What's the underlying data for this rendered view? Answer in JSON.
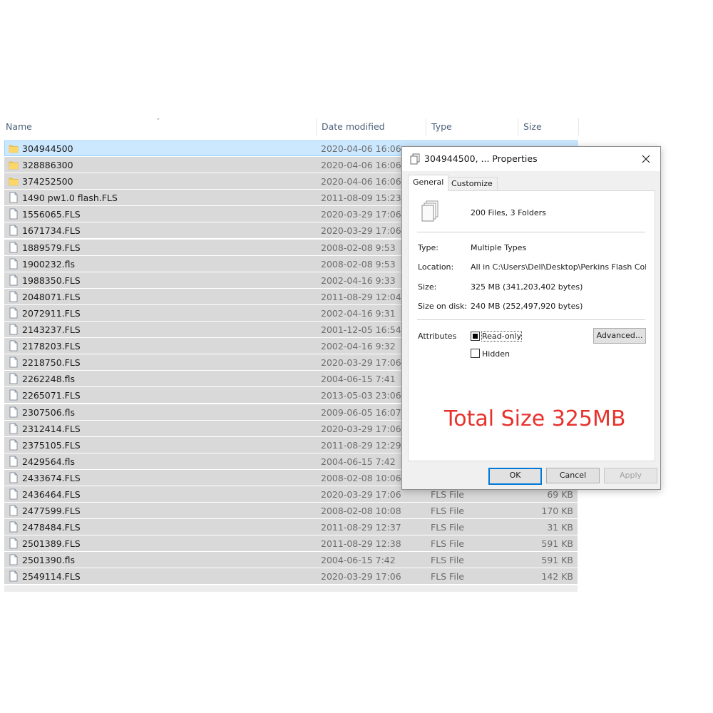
{
  "columns": {
    "name": "Name",
    "date": "Date modified",
    "type": "Type",
    "size": "Size"
  },
  "rows": [
    {
      "name": "304944500",
      "date": "2020-04-06 16:06",
      "type": "",
      "size": "",
      "icon": "folder-icon",
      "selected": true
    },
    {
      "name": "328886300",
      "date": "2020-04-06 16:06",
      "type": "",
      "size": "",
      "icon": "folder-icon"
    },
    {
      "name": "374252500",
      "date": "2020-04-06 16:06",
      "type": "",
      "size": "",
      "icon": "folder-icon"
    },
    {
      "name": "1490 pw1.0 flash.FLS",
      "date": "2011-08-09 15:23",
      "type": "",
      "size": "",
      "icon": "file-icon"
    },
    {
      "name": "1556065.FLS",
      "date": "2020-03-29 17:06",
      "type": "",
      "size": "",
      "icon": "file-icon"
    },
    {
      "name": "1671734.FLS",
      "date": "2020-03-29 17:06",
      "type": "",
      "size": "",
      "icon": "file-icon"
    },
    {
      "name": "1889579.FLS",
      "date": "2008-02-08 9:53",
      "type": "",
      "size": "",
      "icon": "file-icon"
    },
    {
      "name": "1900232.fls",
      "date": "2008-02-08 9:53",
      "type": "",
      "size": "",
      "icon": "file-icon"
    },
    {
      "name": "1988350.FLS",
      "date": "2002-04-16 9:33",
      "type": "",
      "size": "",
      "icon": "file-icon"
    },
    {
      "name": "2048071.FLS",
      "date": "2011-08-29 12:04",
      "type": "",
      "size": "",
      "icon": "file-icon"
    },
    {
      "name": "2072911.FLS",
      "date": "2002-04-16 9:31",
      "type": "",
      "size": "",
      "icon": "file-icon"
    },
    {
      "name": "2143237.FLS",
      "date": "2001-12-05 16:54",
      "type": "",
      "size": "",
      "icon": "file-icon"
    },
    {
      "name": "2178203.FLS",
      "date": "2002-04-16 9:32",
      "type": "",
      "size": "",
      "icon": "file-icon"
    },
    {
      "name": "2218750.FLS",
      "date": "2020-03-29 17:06",
      "type": "",
      "size": "",
      "icon": "file-icon"
    },
    {
      "name": "2262248.fls",
      "date": "2004-06-15 7:41",
      "type": "",
      "size": "",
      "icon": "file-icon"
    },
    {
      "name": "2265071.FLS",
      "date": "2013-05-03 23:06",
      "type": "",
      "size": "",
      "icon": "file-icon"
    },
    {
      "name": "2307506.fls",
      "date": "2009-06-05 16:07",
      "type": "",
      "size": "",
      "icon": "file-icon"
    },
    {
      "name": "2312414.FLS",
      "date": "2020-03-29 17:06",
      "type": "",
      "size": "",
      "icon": "file-icon"
    },
    {
      "name": "2375105.FLS",
      "date": "2011-08-29 12:29",
      "type": "",
      "size": "",
      "icon": "file-icon"
    },
    {
      "name": "2429564.fls",
      "date": "2004-06-15 7:42",
      "type": "",
      "size": "",
      "icon": "file-icon"
    },
    {
      "name": "2433674.FLS",
      "date": "2008-02-08 10:06",
      "type": "",
      "size": "",
      "icon": "file-icon"
    },
    {
      "name": "2436464.FLS",
      "date": "2020-03-29 17:06",
      "type": "FLS File",
      "size": "69 KB",
      "icon": "file-icon"
    },
    {
      "name": "2477599.FLS",
      "date": "2008-02-08 10:08",
      "type": "FLS File",
      "size": "170 KB",
      "icon": "file-icon"
    },
    {
      "name": "2478484.FLS",
      "date": "2011-08-29 12:37",
      "type": "FLS File",
      "size": "31 KB",
      "icon": "file-icon"
    },
    {
      "name": "2501389.FLS",
      "date": "2011-08-29 12:38",
      "type": "FLS File",
      "size": "591 KB",
      "icon": "file-icon"
    },
    {
      "name": "2501390.fls",
      "date": "2004-06-15 7:42",
      "type": "FLS File",
      "size": "591 KB",
      "icon": "file-icon"
    },
    {
      "name": "2549114.FLS",
      "date": "2020-03-29 17:06",
      "type": "FLS File",
      "size": "142 KB",
      "icon": "file-icon"
    }
  ],
  "dialog": {
    "title": "304944500, ... Properties",
    "tabs": {
      "general": "General",
      "customize": "Customize"
    },
    "summary": "200 Files, 3 Folders",
    "type_label": "Type:",
    "type_value": "Multiple Types",
    "location_label": "Location:",
    "location_value": "All in C:\\Users\\Dell\\Desktop\\Perkins Flash Collectio",
    "size_label": "Size:",
    "size_value": "325 MB (341,203,402 bytes)",
    "disk_label": "Size on disk:",
    "disk_value": "240 MB (252,497,920 bytes)",
    "attributes_label": "Attributes",
    "readonly_label": "Read-only",
    "readonly_checked": true,
    "hidden_label": "Hidden",
    "hidden_checked": false,
    "advanced_label": "Advanced...",
    "promo": "Total Size 325MB",
    "ok_label": "OK",
    "cancel_label": "Cancel",
    "apply_label": "Apply",
    "accent": "#0078d7",
    "promo_color": "#e8322d"
  }
}
